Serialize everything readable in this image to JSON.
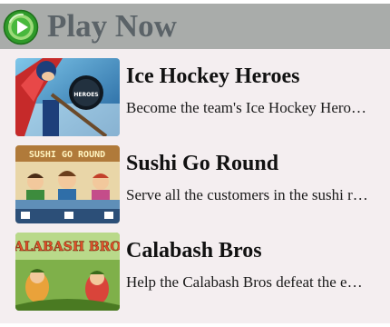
{
  "header": {
    "title": "Play Now",
    "icon": "play-icon",
    "accent": "#3fae3a"
  },
  "games": [
    {
      "title": "Ice Hockey Heroes",
      "description": "Become the team's Ice Hockey Hero and lead them to victory",
      "thumb_text": "HEROES"
    },
    {
      "title": "Sushi Go Round",
      "description": "Serve all the customers in the sushi restaurant",
      "thumb_text": "SUSHI GO ROUND"
    },
    {
      "title": "Calabash Bros",
      "description": "Help the Calabash Bros defeat the evil spirits",
      "thumb_text": "CALABASH BROS"
    }
  ]
}
